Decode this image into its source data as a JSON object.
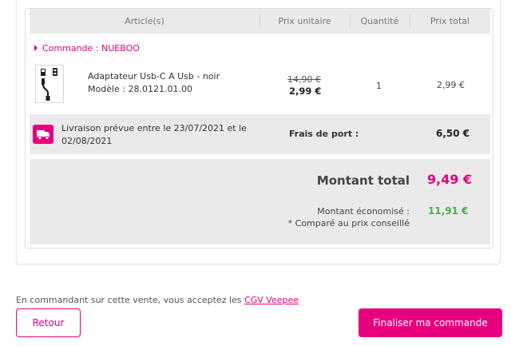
{
  "table": {
    "headers": [
      "Article(s)",
      "Prix unitaire",
      "Quantité",
      "Prix total"
    ]
  },
  "order": {
    "label": "Commande : NUEBOO"
  },
  "product": {
    "name": "Adaptateur Usb-C A Usb - noir",
    "model": "Modèle : 28.0121.01.00",
    "old_price": "14,90 €",
    "new_price": "2,99 €",
    "quantity": "1",
    "total": "2,99 €",
    "thumbnail_icon": "usb-adapter-icon"
  },
  "shipping": {
    "icon": "truck-icon",
    "text": "Livraison prévue entre le 23/07/2021 et le 02/08/2021",
    "label": "Frais de port :",
    "value": "6,50 €"
  },
  "summary": {
    "total_label": "Montant total",
    "total_value": "9,49 €",
    "savings_label": "Montant économisé :",
    "savings_note": "* Comparé au prix conseillé",
    "savings_value": "11,91 €"
  },
  "footer": {
    "cgv_text": "En commandant sur cette vente, vous acceptez les",
    "cgv_link": "CGV Veepee",
    "back_label": "Retour",
    "confirm_label": "Finaliser ma commande"
  },
  "colors": {
    "accent": "#e6007e",
    "savings": "#4caf50",
    "row_background": "#eaeaea"
  }
}
